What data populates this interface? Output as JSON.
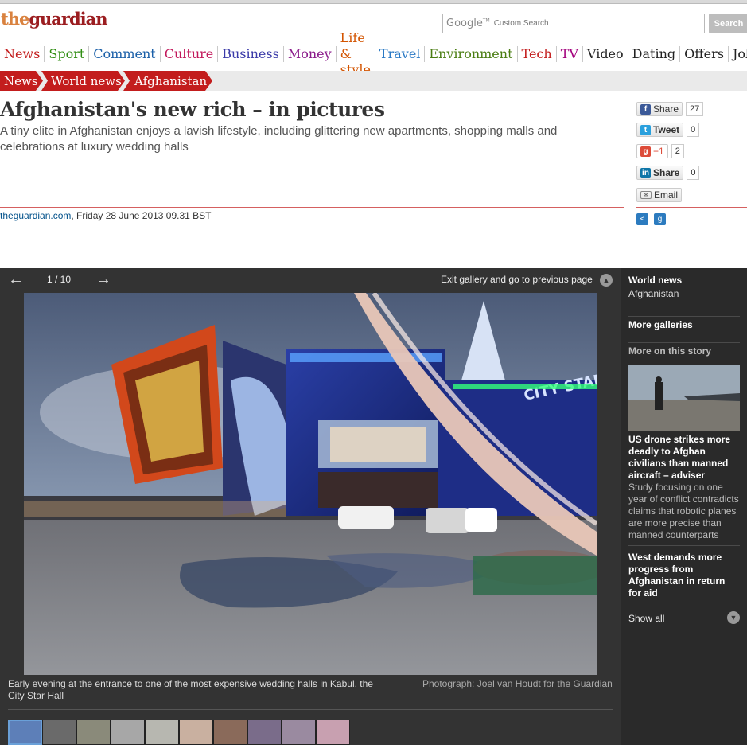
{
  "site": {
    "logo_the": "the",
    "logo_guardian": "guardian",
    "search_brand": "Google",
    "search_tm": "TM",
    "search_placeholder": "Custom Search",
    "search_button": "Search"
  },
  "nav": [
    {
      "label": "News",
      "color": "#c31d1d"
    },
    {
      "label": "Sport",
      "color": "#2f8d12"
    },
    {
      "label": "Comment",
      "color": "#1a5fa8"
    },
    {
      "label": "Culture",
      "color": "#c2185b"
    },
    {
      "label": "Business",
      "color": "#3a3aa8"
    },
    {
      "label": "Money",
      "color": "#8a1a8a"
    },
    {
      "label": "Life & style",
      "color": "#d35400"
    },
    {
      "label": "Travel",
      "color": "#2a79c5"
    },
    {
      "label": "Environment",
      "color": "#4a7d12"
    },
    {
      "label": "Tech",
      "color": "#c31d1d"
    },
    {
      "label": "TV",
      "color": "#a3007d"
    },
    {
      "label": "Video",
      "color": "#222222"
    },
    {
      "label": "Dating",
      "color": "#222222"
    },
    {
      "label": "Offers",
      "color": "#222222"
    },
    {
      "label": "Jobs",
      "color": "#222222"
    }
  ],
  "breadcrumb": [
    "News",
    "World news",
    "Afghanistan"
  ],
  "article": {
    "headline": "Afghanistan's new rich – in pictures",
    "standfirst": "A tiny elite in Afghanistan enjoys a lavish lifestyle, including glittering new apartments, shopping malls and celebrations at luxury wedding halls",
    "byline_site": "theguardian.com",
    "byline_date": ", Friday 28 June 2013 09.31 BST"
  },
  "social": {
    "facebook_label": "Share",
    "facebook_count": "27",
    "twitter_label": "Tweet",
    "twitter_count": "0",
    "gplus_label": "+1",
    "gplus_count": "2",
    "linkedin_label": "Share",
    "linkedin_count": "0",
    "email_label": "Email"
  },
  "gallery": {
    "counter": "1 / 10",
    "exit_label": "Exit gallery and go to previous page",
    "caption": "Early evening at the entrance to one of the most expensive wedding halls in Kabul, the City Star Hall",
    "credit": "Photograph: Joel van Houdt for the Guardian",
    "photo_sign": "CITY STAR",
    "thumb_count": 10
  },
  "sidebar": {
    "section_title": "World news",
    "section_sub": "Afghanistan",
    "more_galleries": "More galleries",
    "more_on_story": "More on this story",
    "story1_title": "US drone strikes more deadly to Afghan civilians than manned aircraft – adviser",
    "story1_desc": "Study focusing on one year of conflict contradicts claims that robotic planes are more precise than manned counterparts",
    "story2_title": "West demands more progress from Afghanistan in return for aid",
    "show_all": "Show all"
  }
}
